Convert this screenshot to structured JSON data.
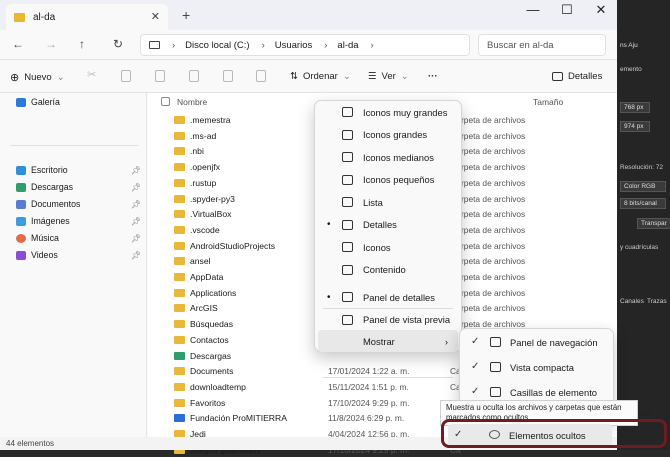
{
  "window": {
    "tab_title": "al-da",
    "tab_close": "✕",
    "new_tab": "+",
    "minimize": "—",
    "maximize": "☐",
    "close": "✕"
  },
  "nav": {
    "back": "←",
    "forward": "→",
    "up": "↑",
    "refresh": "↻",
    "more": "›",
    "breadcrumb": [
      "Disco local (C:)",
      "Usuarios",
      "al-da"
    ],
    "search_placeholder": "Buscar en al-da"
  },
  "toolbar": {
    "new_label": "Nuevo",
    "sort_label": "Ordenar",
    "view_label": "Ver",
    "more_label": "···",
    "details_label": "Detalles"
  },
  "sidebar": {
    "items": [
      {
        "label": "Galería",
        "color": "#2b79d8",
        "pinned": false
      },
      {
        "label": "Escritorio",
        "color": "#2f8fd9",
        "pinned": true
      },
      {
        "label": "Descargas",
        "color": "#2f9e6b",
        "pinned": true
      },
      {
        "label": "Documentos",
        "color": "#5a7bd2",
        "pinned": true
      },
      {
        "label": "Imágenes",
        "color": "#3d9be0",
        "pinned": true
      },
      {
        "label": "Música",
        "color": "#e46a4c",
        "pinned": true
      },
      {
        "label": "Videos",
        "color": "#8a4fd1",
        "pinned": true
      }
    ]
  },
  "columns": {
    "name": "Nombre",
    "type_partial": "o",
    "size": "Tamaño"
  },
  "files": [
    {
      "name": ".memestra",
      "date": "",
      "type": "rpeta de archivos"
    },
    {
      "name": ".ms-ad",
      "date": "",
      "type": "rpeta de archivos"
    },
    {
      "name": ".nbi",
      "date": "",
      "type": "rpeta de archivos"
    },
    {
      "name": ".openjfx",
      "date": "",
      "type": "rpeta de archivos"
    },
    {
      "name": ".rustup",
      "date": "",
      "type": "rpeta de archivos"
    },
    {
      "name": ".spyder-py3",
      "date": "",
      "type": "rpeta de archivos"
    },
    {
      "name": ".VirtualBox",
      "date": "",
      "type": "rpeta de archivos"
    },
    {
      "name": ".vscode",
      "date": "",
      "type": "rpeta de archivos"
    },
    {
      "name": "AndroidStudioProjects",
      "date": "",
      "type": "rpeta de archivos"
    },
    {
      "name": "ansel",
      "date": "",
      "type": "rpeta de archivos"
    },
    {
      "name": "AppData",
      "date": "",
      "type": "rpeta de archivos"
    },
    {
      "name": "Applications",
      "date": "",
      "type": "rpeta de archivos"
    },
    {
      "name": "ArcGIS",
      "date": "",
      "type": "rpeta de archivos"
    },
    {
      "name": "Búsquedas",
      "date": "",
      "type": "rpeta de archivos"
    },
    {
      "name": "Contactos",
      "date": "",
      "type": ""
    },
    {
      "name": "Descargas",
      "date": "",
      "type": ""
    },
    {
      "name": "Documents",
      "date": "17/01/2024 1:22 a. m.",
      "type": "Ca"
    },
    {
      "name": "downloadtemp",
      "date": "15/11/2024 1:51 p. m.",
      "type": "Ca"
    },
    {
      "name": "Favoritos",
      "date": "17/10/2024 9:29 p. m.",
      "type": "Ca"
    },
    {
      "name": "Fundación ProMITIERRA",
      "date": "11/8/2024 6:29 p. m.",
      "type": "Ca"
    },
    {
      "name": "Jedi",
      "date": "4/04/2024 12:56 p. m.",
      "type": "Ca"
    },
    {
      "name": "Juegos guardados",
      "date": "17/10/2024 9:29 p. m.",
      "type": "Ca"
    }
  ],
  "view_menu": {
    "items": [
      {
        "label": "Iconos muy grandes",
        "selected": false
      },
      {
        "label": "Iconos grandes",
        "selected": false
      },
      {
        "label": "Iconos medianos",
        "selected": false
      },
      {
        "label": "Iconos pequeños",
        "selected": false
      },
      {
        "label": "Lista",
        "selected": false
      },
      {
        "label": "Detalles",
        "selected": true
      },
      {
        "label": "Iconos",
        "selected": false
      },
      {
        "label": "Contenido",
        "selected": false
      },
      {
        "label": "Panel de detalles",
        "selected": true
      },
      {
        "label": "Panel de vista previa",
        "selected": false
      }
    ],
    "show_label": "Mostrar",
    "show_arrow": "›"
  },
  "show_submenu": {
    "items": [
      {
        "label": "Panel de navegación",
        "checked": true
      },
      {
        "label": "Vista compacta",
        "checked": true
      },
      {
        "label": "Casillas de elemento",
        "checked": true
      }
    ],
    "hidden_items": {
      "label": "Elementos ocultos",
      "checked": true
    }
  },
  "tooltip": "Muestra u oculta los archivos y carpetas que están marcados como ocultos.",
  "tooltip_overflow": "ivo",
  "status": {
    "count": "44 elementos"
  },
  "photoshop": {
    "tabs": "ns  Aju",
    "label1": "emento",
    "width": "768 px",
    "height": "974 px",
    "resolution": "Resolución: 72",
    "mode": "Color RGB",
    "bits": "8 bits/canal",
    "transp": "Transpar",
    "grid": "y cuadrículas",
    "capas": "Canales",
    "trazas": "Trazas"
  }
}
